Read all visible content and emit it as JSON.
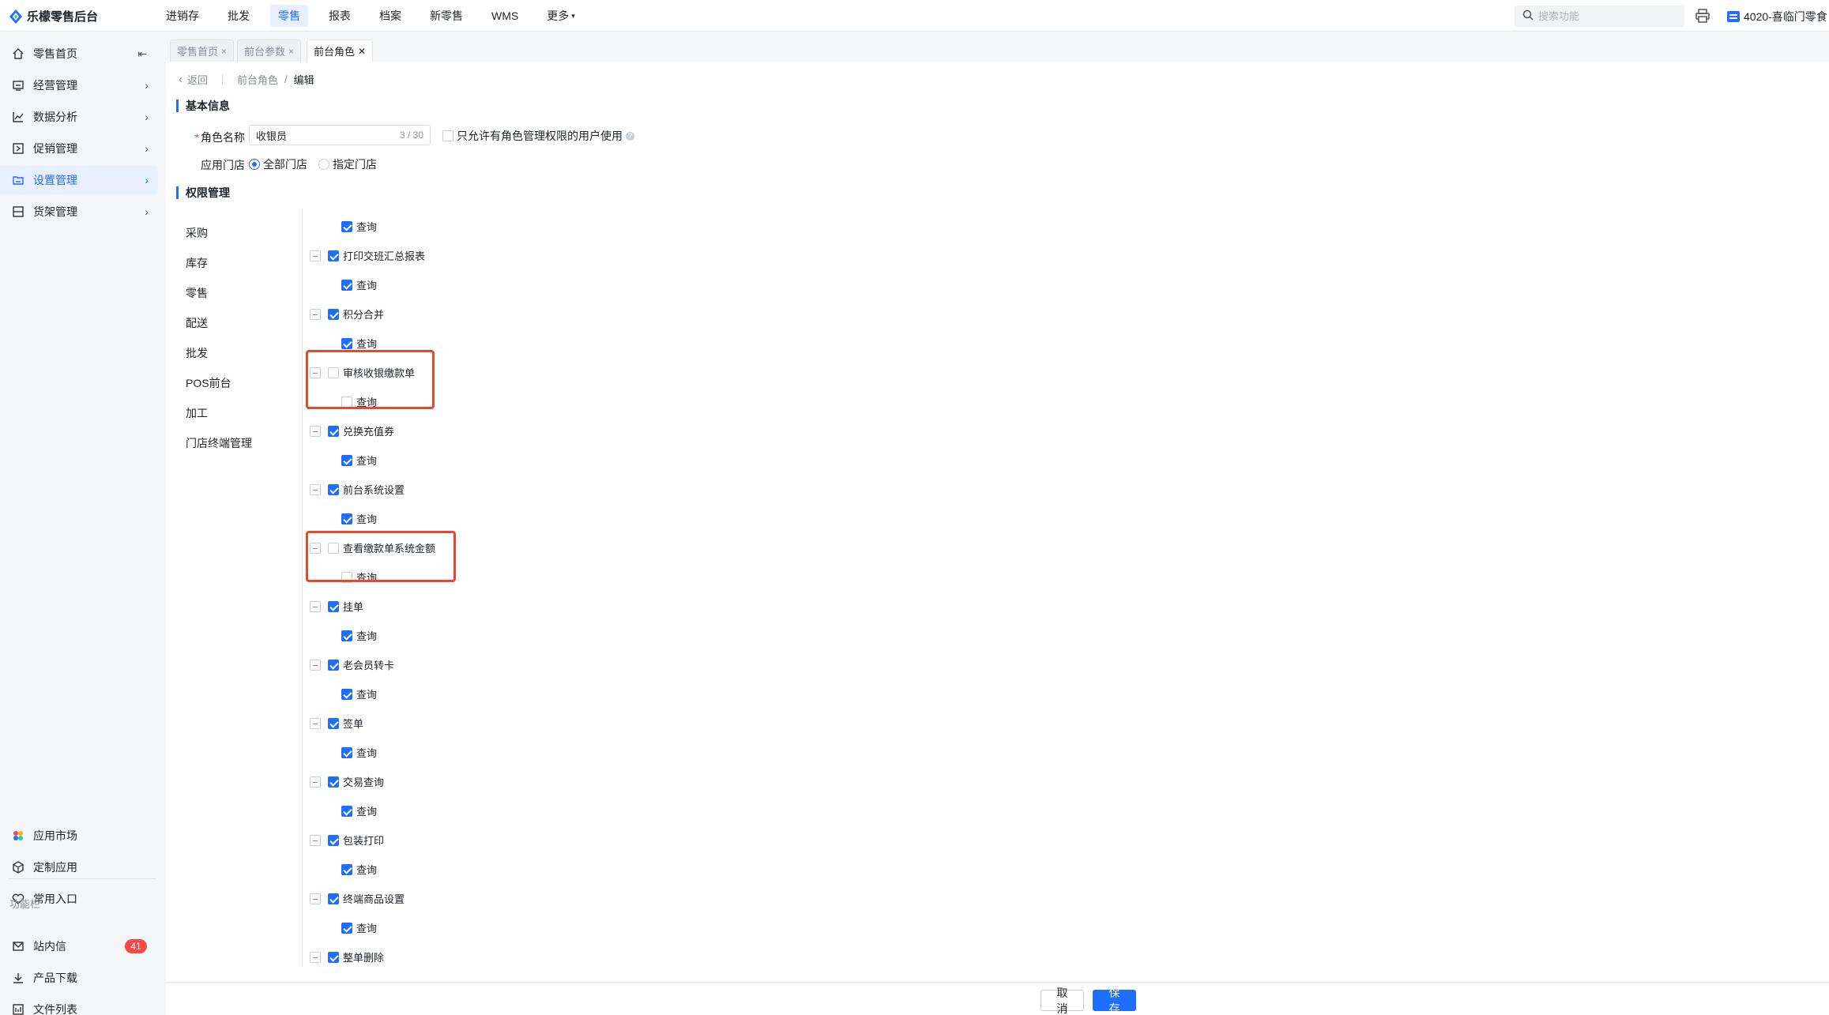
{
  "app": {
    "title": "乐檬零售后台"
  },
  "topnav": {
    "items": [
      "进销存",
      "批发",
      "零售",
      "报表",
      "档案",
      "新零售",
      "WMS",
      "更多"
    ],
    "active_index": 2
  },
  "search": {
    "placeholder": "搜索功能"
  },
  "store": {
    "label": "4020-喜临门零食"
  },
  "sidebar": {
    "items": [
      "零售首页",
      "经营管理",
      "数据分析",
      "促销管理",
      "设置管理",
      "货架管理"
    ],
    "active_index": 4,
    "bottom_items": [
      "应用市场",
      "定制应用",
      "常用入口"
    ],
    "section_label": "功能栏",
    "func_items": [
      "站内信",
      "产品下载",
      "文件列表"
    ],
    "message_count": "41"
  },
  "tabs": [
    {
      "label": "零售首页",
      "close": "×"
    },
    {
      "label": "前台参数",
      "close": "×"
    },
    {
      "label": "前台角色",
      "close": "✕"
    }
  ],
  "breadcrumb": {
    "back": "返回",
    "parent": "前台角色",
    "sep": "/",
    "current": "编辑"
  },
  "basic": {
    "title": "基本信息",
    "name_label": "角色名称",
    "name_value": "收银员",
    "name_count": "3 / 30",
    "restrict_label": "只允许有角色管理权限的用户使用",
    "store_label": "应用门店",
    "store_options": [
      "全部门店",
      "指定门店"
    ],
    "store_selected": 0
  },
  "permissions": {
    "title": "权限管理",
    "categories": [
      "采购",
      "库存",
      "零售",
      "配送",
      "批发",
      "POS前台",
      "加工",
      "门店终端管理"
    ],
    "first_child": "查询",
    "groups": [
      {
        "name": "打印交班汇总报表",
        "checked": true,
        "child": "查询"
      },
      {
        "name": "积分合并",
        "checked": true,
        "child": "查询"
      },
      {
        "name": "审核收银缴款单",
        "checked": false,
        "child": "查询"
      },
      {
        "name": "兑换充值券",
        "checked": true,
        "child": "查询"
      },
      {
        "name": "前台系统设置",
        "checked": true,
        "child": "查询"
      },
      {
        "name": "查看缴款单系统金额",
        "checked": false,
        "child": "查询"
      },
      {
        "name": "挂单",
        "checked": true,
        "child": "查询"
      },
      {
        "name": "老会员转卡",
        "checked": true,
        "child": "查询"
      },
      {
        "name": "签单",
        "checked": true,
        "child": "查询"
      },
      {
        "name": "交易查询",
        "checked": true,
        "child": "查询"
      },
      {
        "name": "包装打印",
        "checked": true,
        "child": "查询"
      },
      {
        "name": "终端商品设置",
        "checked": true,
        "child": "查询"
      },
      {
        "name": "整单删除",
        "checked": true,
        "child": ""
      }
    ]
  },
  "footer": {
    "cancel": "取 消",
    "save": "保 存"
  },
  "colors": {
    "accent": "#1e6eff",
    "highlight": "#e64a2e",
    "badge": "#f54a45"
  }
}
